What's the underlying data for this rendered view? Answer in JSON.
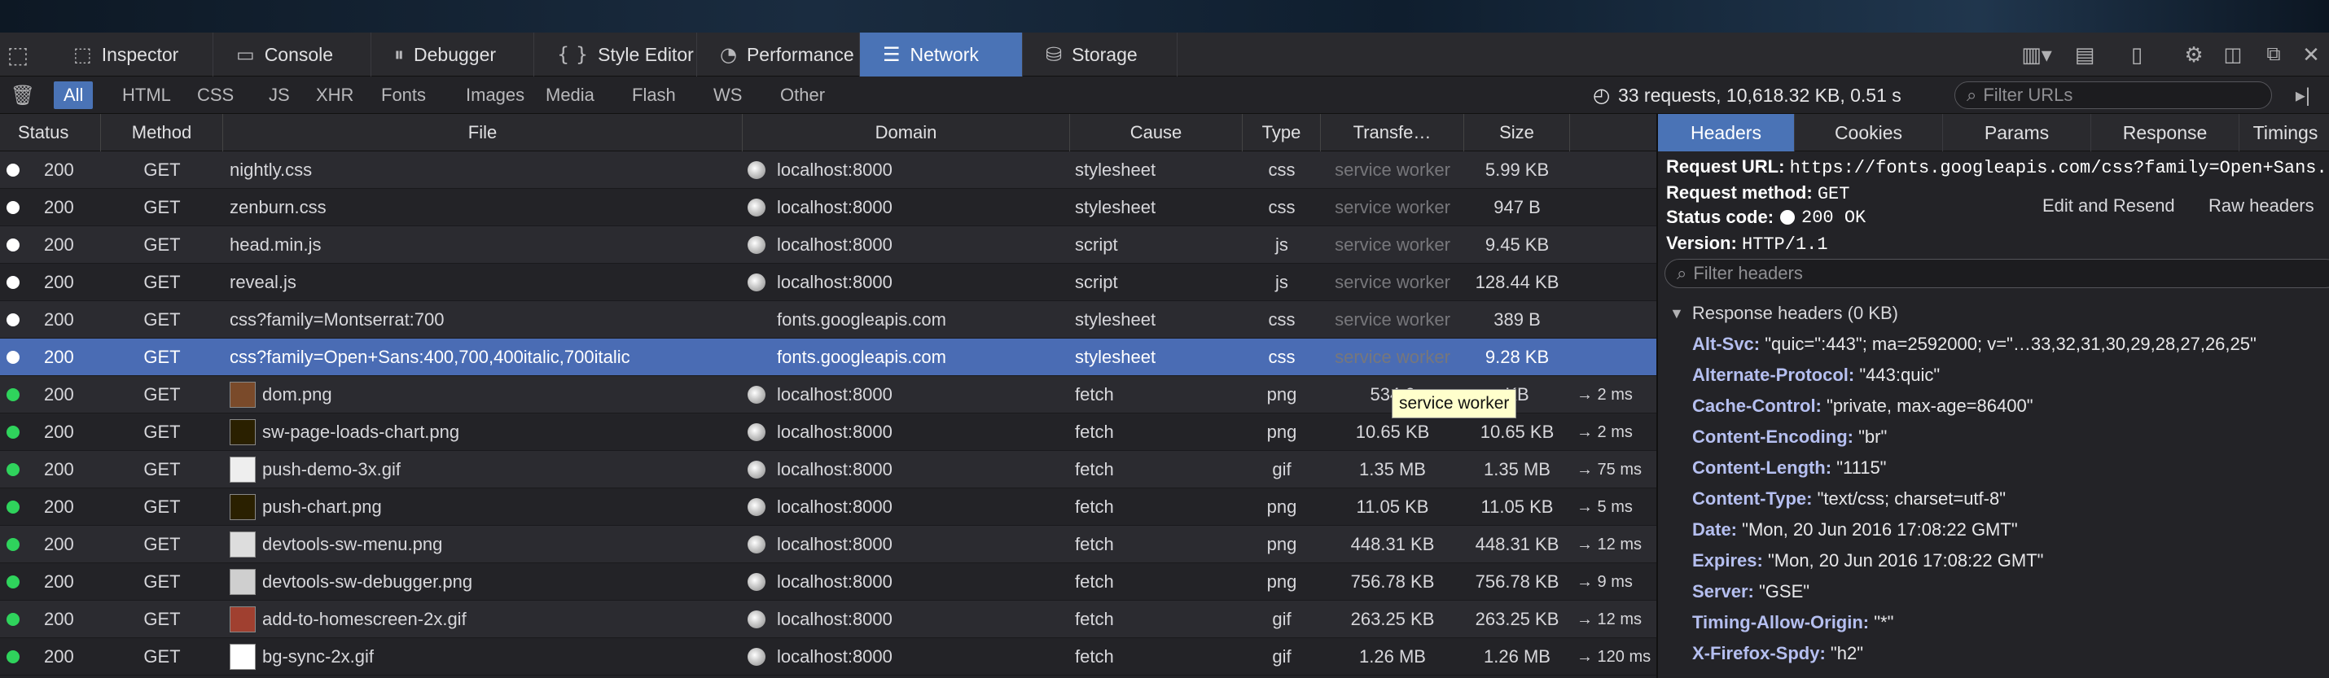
{
  "toolbar": {
    "tabs": [
      {
        "label": "Inspector",
        "icon": "inspector-icon",
        "glyph": "⬚"
      },
      {
        "label": "Console",
        "icon": "console-icon",
        "glyph": "▭"
      },
      {
        "label": "Debugger",
        "icon": "debugger-icon",
        "glyph": "⏸"
      },
      {
        "label": "Style Editor",
        "icon": "style-editor-icon",
        "glyph": "{ }"
      },
      {
        "label": "Performance",
        "icon": "performance-icon",
        "glyph": "◔"
      },
      {
        "label": "Network",
        "icon": "network-icon",
        "glyph": "☰"
      },
      {
        "label": "Storage",
        "icon": "storage-icon",
        "glyph": "⛁"
      }
    ],
    "active_tab": "Network"
  },
  "filters": {
    "types": [
      "All",
      "HTML",
      "CSS",
      "JS",
      "XHR",
      "Fonts",
      "Images",
      "Media",
      "Flash",
      "WS",
      "Other"
    ],
    "active": "All",
    "summary": "33 requests, 10,618.32 KB, 0.51 s",
    "filter_placeholder": "Filter URLs"
  },
  "columns": [
    "Status",
    "Method",
    "File",
    "Domain",
    "Cause",
    "Type",
    "Transfe…",
    "Size"
  ],
  "requests": [
    {
      "status": "200",
      "method": "GET",
      "file": "nightly.css",
      "domain": "localhost:8000",
      "cause": "stylesheet",
      "type": "css",
      "transferred": "service worker",
      "size": "5.99 KB",
      "timing": "",
      "dot": "#ffffff",
      "globe": true,
      "thumb": ""
    },
    {
      "status": "200",
      "method": "GET",
      "file": "zenburn.css",
      "domain": "localhost:8000",
      "cause": "stylesheet",
      "type": "css",
      "transferred": "service worker",
      "size": "947 B",
      "timing": "",
      "dot": "#ffffff",
      "globe": true,
      "thumb": ""
    },
    {
      "status": "200",
      "method": "GET",
      "file": "head.min.js",
      "domain": "localhost:8000",
      "cause": "script",
      "type": "js",
      "transferred": "service worker",
      "size": "9.45 KB",
      "timing": "",
      "dot": "#ffffff",
      "globe": true,
      "thumb": ""
    },
    {
      "status": "200",
      "method": "GET",
      "file": "reveal.js",
      "domain": "localhost:8000",
      "cause": "script",
      "type": "js",
      "transferred": "service worker",
      "size": "128.44 KB",
      "timing": "",
      "dot": "#ffffff",
      "globe": true,
      "thumb": ""
    },
    {
      "status": "200",
      "method": "GET",
      "file": "css?family=Montserrat:700",
      "domain": "fonts.googleapis.com",
      "cause": "stylesheet",
      "type": "css",
      "transferred": "service worker",
      "size": "389 B",
      "timing": "",
      "dot": "#ffffff",
      "globe": false,
      "thumb": ""
    },
    {
      "status": "200",
      "method": "GET",
      "file": "css?family=Open+Sans:400,700,400italic,700italic",
      "domain": "fonts.googleapis.com",
      "cause": "stylesheet",
      "type": "css",
      "transferred": "service worker",
      "size": "9.28 KB",
      "timing": "",
      "dot": "#ffffff",
      "globe": false,
      "thumb": "",
      "selected": true
    },
    {
      "status": "200",
      "method": "GET",
      "file": "dom.png",
      "domain": "localhost:8000",
      "cause": "fetch",
      "type": "png",
      "transferred": "534.6",
      "size": "KB",
      "timing": "→ 2 ms",
      "dot": "#2fd35c",
      "globe": true,
      "thumb": "#7a4a2a"
    },
    {
      "status": "200",
      "method": "GET",
      "file": "sw-page-loads-chart.png",
      "domain": "localhost:8000",
      "cause": "fetch",
      "type": "png",
      "transferred": "10.65 KB",
      "size": "10.65 KB",
      "timing": "→ 2 ms",
      "dot": "#2fd35c",
      "globe": true,
      "thumb": "#2a2000"
    },
    {
      "status": "200",
      "method": "GET",
      "file": "push-demo-3x.gif",
      "domain": "localhost:8000",
      "cause": "fetch",
      "type": "gif",
      "transferred": "1.35 MB",
      "size": "1.35 MB",
      "timing": "→ 75 ms",
      "dot": "#2fd35c",
      "globe": true,
      "thumb": "#eeeeee"
    },
    {
      "status": "200",
      "method": "GET",
      "file": "push-chart.png",
      "domain": "localhost:8000",
      "cause": "fetch",
      "type": "png",
      "transferred": "11.05 KB",
      "size": "11.05 KB",
      "timing": "→ 5 ms",
      "dot": "#2fd35c",
      "globe": true,
      "thumb": "#2a2000"
    },
    {
      "status": "200",
      "method": "GET",
      "file": "devtools-sw-menu.png",
      "domain": "localhost:8000",
      "cause": "fetch",
      "type": "png",
      "transferred": "448.31 KB",
      "size": "448.31 KB",
      "timing": "→ 12 ms",
      "dot": "#2fd35c",
      "globe": true,
      "thumb": "#dddddd"
    },
    {
      "status": "200",
      "method": "GET",
      "file": "devtools-sw-debugger.png",
      "domain": "localhost:8000",
      "cause": "fetch",
      "type": "png",
      "transferred": "756.78 KB",
      "size": "756.78 KB",
      "timing": "→ 9 ms",
      "dot": "#2fd35c",
      "globe": true,
      "thumb": "#cfcfcf"
    },
    {
      "status": "200",
      "method": "GET",
      "file": "add-to-homescreen-2x.gif",
      "domain": "localhost:8000",
      "cause": "fetch",
      "type": "gif",
      "transferred": "263.25 KB",
      "size": "263.25 KB",
      "timing": "→ 12 ms",
      "dot": "#2fd35c",
      "globe": true,
      "thumb": "#a04030"
    },
    {
      "status": "200",
      "method": "GET",
      "file": "bg-sync-2x.gif",
      "domain": "localhost:8000",
      "cause": "fetch",
      "type": "gif",
      "transferred": "1.26 MB",
      "size": "1.26 MB",
      "timing": "→ 120 ms",
      "dot": "#2fd35c",
      "globe": true,
      "thumb": "#ffffff"
    }
  ],
  "tooltip": "service worker",
  "panel": {
    "tabs": [
      "Headers",
      "Cookies",
      "Params",
      "Response",
      "Timings"
    ],
    "active": "Headers",
    "request_url_label": "Request URL:",
    "request_url": "https://fonts.googleapis.com/css?family=Open+Sans...",
    "method_label": "Request method:",
    "method": "GET",
    "status_label": "Status code:",
    "status": "200 OK",
    "version_label": "Version:",
    "version": "HTTP/1.1",
    "edit_resend": "Edit and Resend",
    "raw_headers": "Raw headers",
    "filter_headers_placeholder": "Filter headers",
    "response_headers_title": "Response headers (0 KB)",
    "response_headers": [
      {
        "key": "Alt-Svc:",
        "value": "\"quic=\":443\"; ma=2592000; v=\"…33,32,31,30,29,28,27,26,25\""
      },
      {
        "key": "Alternate-Protocol:",
        "value": "\"443:quic\""
      },
      {
        "key": "Cache-Control:",
        "value": "\"private, max-age=86400\""
      },
      {
        "key": "Content-Encoding:",
        "value": "\"br\""
      },
      {
        "key": "Content-Length:",
        "value": "\"1115\""
      },
      {
        "key": "Content-Type:",
        "value": "\"text/css; charset=utf-8\""
      },
      {
        "key": "Date:",
        "value": "\"Mon, 20 Jun 2016 17:08:22 GMT\""
      },
      {
        "key": "Expires:",
        "value": "\"Mon, 20 Jun 2016 17:08:22 GMT\""
      },
      {
        "key": "Server:",
        "value": "\"GSE\""
      },
      {
        "key": "Timing-Allow-Origin:",
        "value": "\"*\""
      },
      {
        "key": "X-Firefox-Spdy:",
        "value": "\"h2\""
      }
    ]
  }
}
